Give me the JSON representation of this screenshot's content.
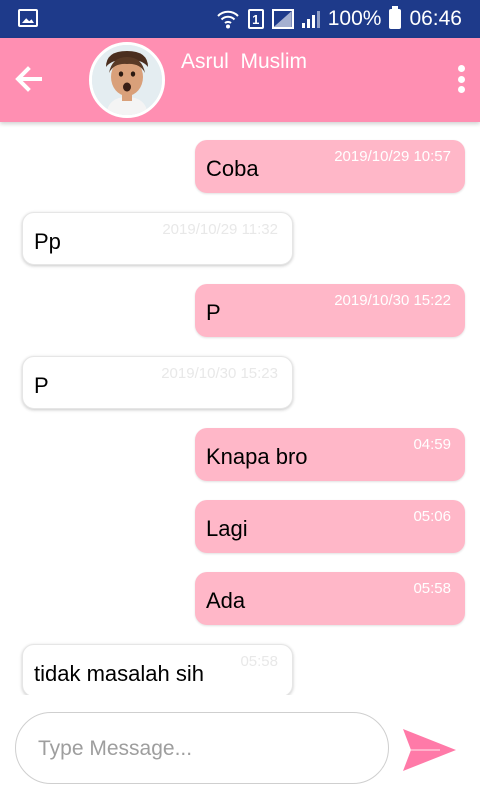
{
  "status_bar": {
    "battery": "100%",
    "sim_slot": "1",
    "time": "06:46",
    "icons": [
      "gallery-icon",
      "wifi-icon",
      "sim-icon",
      "signal-icon",
      "battery-icon"
    ]
  },
  "header": {
    "contact_name": "Asrul  Muslim",
    "background_color": "#ff8fb2",
    "icons": [
      "back-arrow-icon",
      "more-vert-icon"
    ]
  },
  "messages": [
    {
      "direction": "out",
      "text": "Coba",
      "time": "2019/10/29 10:57"
    },
    {
      "direction": "in",
      "text": "Pp",
      "time": "2019/10/29 11:32"
    },
    {
      "direction": "out",
      "text": "P",
      "time": "2019/10/30 15:22"
    },
    {
      "direction": "in",
      "text": "P",
      "time": "2019/10/30 15:23"
    },
    {
      "direction": "out",
      "text": "Knapa bro",
      "time": "04:59"
    },
    {
      "direction": "out",
      "text": "Lagi",
      "time": "05:06"
    },
    {
      "direction": "out",
      "text": "Ada",
      "time": "05:58"
    },
    {
      "direction": "in",
      "text": "tidak masalah sih",
      "time": "05:58"
    }
  ],
  "colors": {
    "outgoing_bubble": "#ffb7c8",
    "incoming_bubble": "#ffffff",
    "send_icon": "#ff7aa8"
  },
  "composer": {
    "placeholder": "Type Message...",
    "value": ""
  }
}
